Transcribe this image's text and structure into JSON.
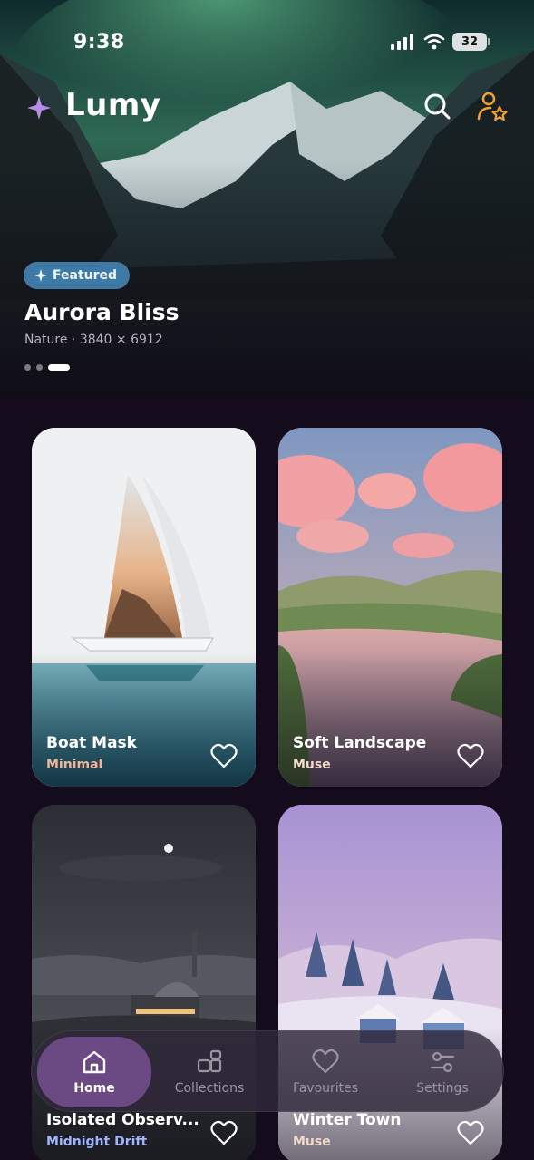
{
  "status_bar": {
    "time": "9:38",
    "battery": "32"
  },
  "header": {
    "app_name": "Lumy",
    "icons": [
      "sparkle-icon",
      "search-icon",
      "user-star-icon"
    ]
  },
  "featured": {
    "badge": "Featured",
    "title": "Aurora Bliss",
    "subtitle": "Nature · 3840 × 6912",
    "pagination": {
      "count": 3,
      "active": 3
    }
  },
  "wallpapers": [
    {
      "title": "Boat Mask",
      "category": "Minimal",
      "category_color": "#f0b59a"
    },
    {
      "title": "Soft Landscape",
      "category": "Muse",
      "category_color": "#f3d9c9"
    },
    {
      "title": "Isolated Observ...",
      "category": "Midnight Drift",
      "category_color": "#9fb6ff"
    },
    {
      "title": "Winter Town",
      "category": "Muse",
      "category_color": "#f3d9c9"
    }
  ],
  "nav": {
    "items": [
      {
        "label": "Home",
        "icon": "home-icon",
        "active": true
      },
      {
        "label": "Collections",
        "icon": "collections-icon",
        "active": false
      },
      {
        "label": "Favourites",
        "icon": "heart-icon",
        "active": false
      },
      {
        "label": "Settings",
        "icon": "sliders-icon",
        "active": false
      }
    ]
  },
  "colors": {
    "background": "#140c1c",
    "accent": "#6b4a84",
    "badge": "#3f7aa6",
    "profile_icon": "#f0a030"
  }
}
